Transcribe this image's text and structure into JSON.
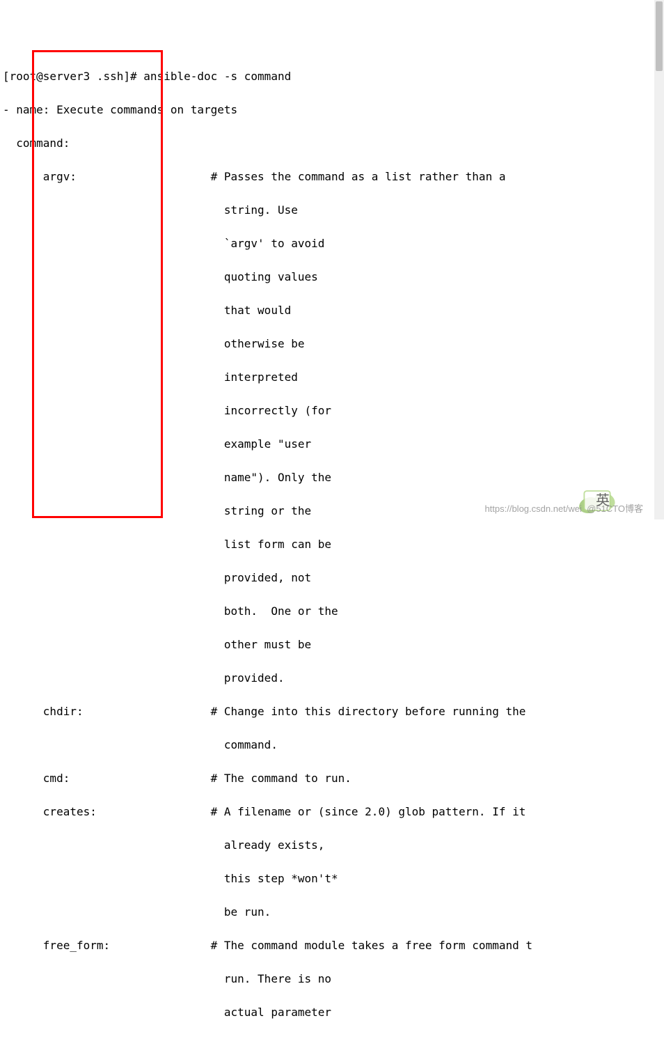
{
  "terminal": {
    "prompt_line": "[root@server3 .ssh]# ansible-doc -s command",
    "output_line_1": "- name: Execute commands on targets",
    "output_line_2": "  command:",
    "params": {
      "argv": {
        "name_line": "      argv:                    # Passes the command as a list rather than a",
        "cont_1": "                                 string. Use",
        "cont_2": "                                 `argv' to avoid",
        "cont_3": "                                 quoting values",
        "cont_4": "                                 that would",
        "cont_5": "                                 otherwise be",
        "cont_6": "                                 interpreted",
        "cont_7": "                                 incorrectly (for",
        "cont_8": "                                 example \"user",
        "cont_9": "                                 name\"). Only the",
        "cont_10": "                                 string or the",
        "cont_11": "                                 list form can be",
        "cont_12": "                                 provided, not",
        "cont_13": "                                 both.  One or the",
        "cont_14": "                                 other must be",
        "cont_15": "                                 provided."
      },
      "chdir": {
        "name_line": "      chdir:                   # Change into this directory before running the",
        "cont_1": "                                 command."
      },
      "cmd": {
        "name_line": "      cmd:                     # The command to run."
      },
      "creates": {
        "name_line": "      creates:                 # A filename or (since 2.0) glob pattern. If it",
        "cont_1": "                                 already exists,",
        "cont_2": "                                 this step *won't*",
        "cont_3": "                                 be run."
      },
      "free_form": {
        "name_line": "      free_form:               # The command module takes a free form command t",
        "cont_1": "                                 run. There is no",
        "cont_2": "                                 actual parameter"
      }
    }
  },
  "watermark_text": "https://blog.csdn.net/wei  @51CTO博客",
  "ime_char": "英"
}
